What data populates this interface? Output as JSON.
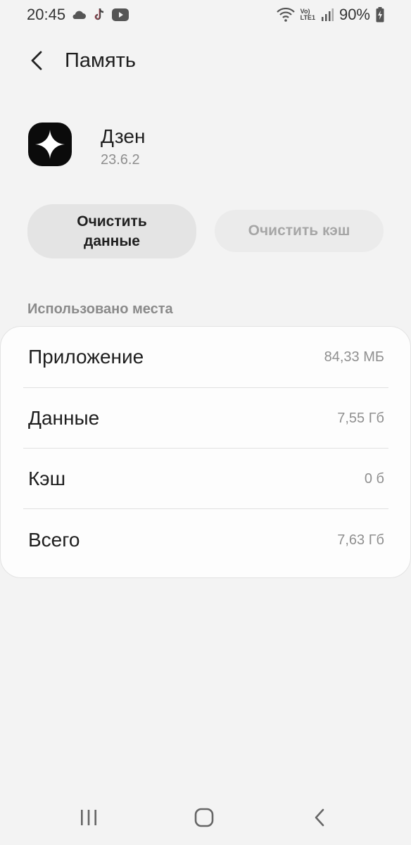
{
  "status_bar": {
    "time": "20:45",
    "battery_percent": "90%",
    "network_label_top": "Vo)",
    "network_label_bottom": "LTE1",
    "icons": [
      "cloud-icon",
      "tiktok-icon",
      "youtube-icon",
      "wifi-icon",
      "signal-icon",
      "battery-charging-icon"
    ]
  },
  "header": {
    "title": "Память",
    "back_icon": "chevron-left-icon"
  },
  "app": {
    "name": "Дзен",
    "version": "23.6.2",
    "icon": "dzen-star-icon"
  },
  "buttons": {
    "clear_data_line1": "Очистить",
    "clear_data_line2": "данные",
    "clear_cache": "Очистить кэш"
  },
  "storage": {
    "section_title": "Использовано места",
    "rows": [
      {
        "label": "Приложение",
        "value": "84,33 МБ"
      },
      {
        "label": "Данные",
        "value": "7,55 Гб"
      },
      {
        "label": "Кэш",
        "value": "0 б"
      },
      {
        "label": "Всего",
        "value": "7,63 Гб"
      }
    ]
  },
  "nav_bar": {
    "icons": [
      "recents-icon",
      "home-icon",
      "back-icon"
    ]
  }
}
